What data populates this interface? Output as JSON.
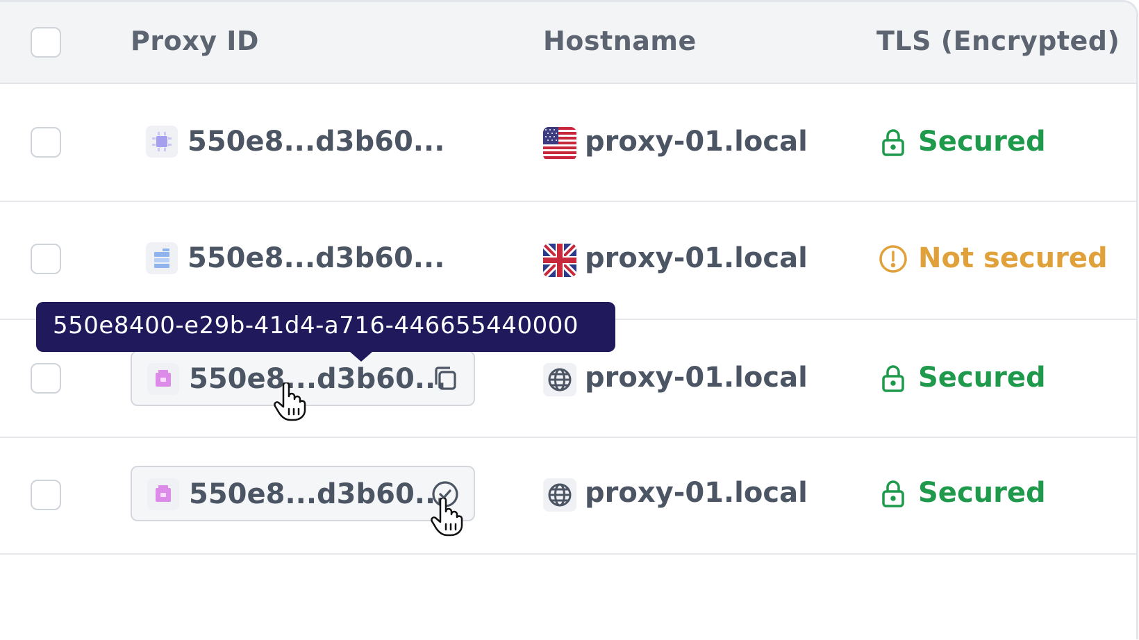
{
  "header": {
    "proxy_id_label": "Proxy ID",
    "hostname_label": "Hostname",
    "tls_label": "TLS (Encrypted)"
  },
  "rows": [
    {
      "proxy_id": "550e8...d3b60...",
      "id_icon": "chip-icon",
      "flag": "us-flag-icon",
      "hostname": "proxy-01.local",
      "tls_status": "Secured",
      "tls_icon": "lock-icon",
      "tls_color": "#1f9a4c"
    },
    {
      "proxy_id": "550e8...d3b60...",
      "id_icon": "server-icon",
      "flag": "uk-flag-icon",
      "hostname": "proxy-01.local",
      "tls_status": "Not secured",
      "tls_icon": "alert-circle-icon",
      "tls_color": "#e0a13a"
    },
    {
      "proxy_id": "550e8...d3b60...",
      "id_icon": "package-icon",
      "flag": "globe-icon",
      "hostname": "proxy-01.local",
      "tls_status": "Secured",
      "tls_icon": "lock-icon",
      "tls_color": "#1f9a4c",
      "action": "copy-icon"
    },
    {
      "proxy_id": "550e8...d3b60...",
      "id_icon": "package-icon",
      "flag": "globe-icon",
      "hostname": "proxy-01.local",
      "tls_status": "Secured",
      "tls_icon": "lock-icon",
      "tls_color": "#1f9a4c",
      "action": "check-circle-icon"
    }
  ],
  "tooltip": {
    "text": "550e8400-e29b-41d4-a716-446655440000"
  },
  "colors": {
    "header_bg": "#f3f4f6",
    "tooltip_bg": "#201a5c",
    "secured": "#1f9a4c",
    "not_secured": "#e0a13a"
  }
}
